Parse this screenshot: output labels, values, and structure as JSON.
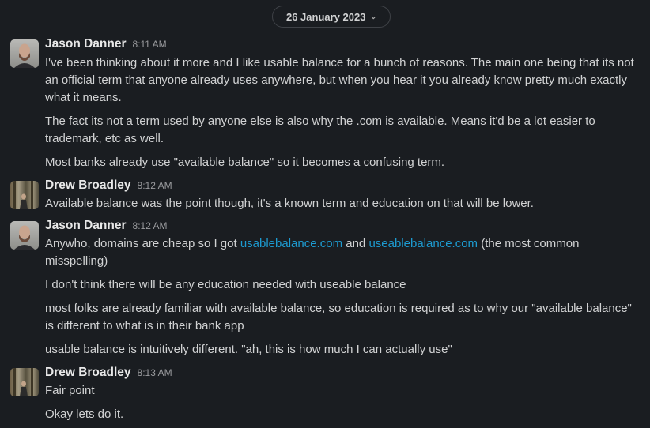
{
  "date_divider": {
    "label": "26 January 2023"
  },
  "messages": [
    {
      "author": "Jason Danner",
      "time": "8:11 AM",
      "paragraphs": [
        "I've been thinking about it more and I like usable balance for a bunch of reasons. The main one being that its not an official term that anyone already uses anywhere, but when you hear it you already know pretty much exactly what it means.",
        "The fact its not a term used by anyone else is also why the .com is available. Means it'd be a lot easier to trademark, etc as well.",
        "Most banks already use \"available balance\" so it becomes a confusing term."
      ]
    },
    {
      "author": "Drew Broadley",
      "time": "8:12 AM",
      "paragraphs": [
        "Available balance was the point though, it's a known term and education on that will be lower."
      ]
    },
    {
      "author": "Jason Danner",
      "time": "8:12 AM",
      "p1_before": "Anywho, domains are cheap so I got ",
      "link1": "usablebalance.com",
      "p1_mid": " and ",
      "link2": "useablebalance.com",
      "p1_after": " (the most common misspelling)",
      "paragraphs": [
        "I don't think there will be any education needed with useable balance",
        "most folks are already familiar with available balance, so education is required as to why our \"available balance\" is different to what is in their bank app",
        "usable balance is intuitively different. \"ah, this is how much I can actually use\""
      ]
    },
    {
      "author": "Drew Broadley",
      "time": "8:13 AM",
      "paragraphs": [
        "Fair point",
        "Okay lets do it."
      ]
    }
  ]
}
